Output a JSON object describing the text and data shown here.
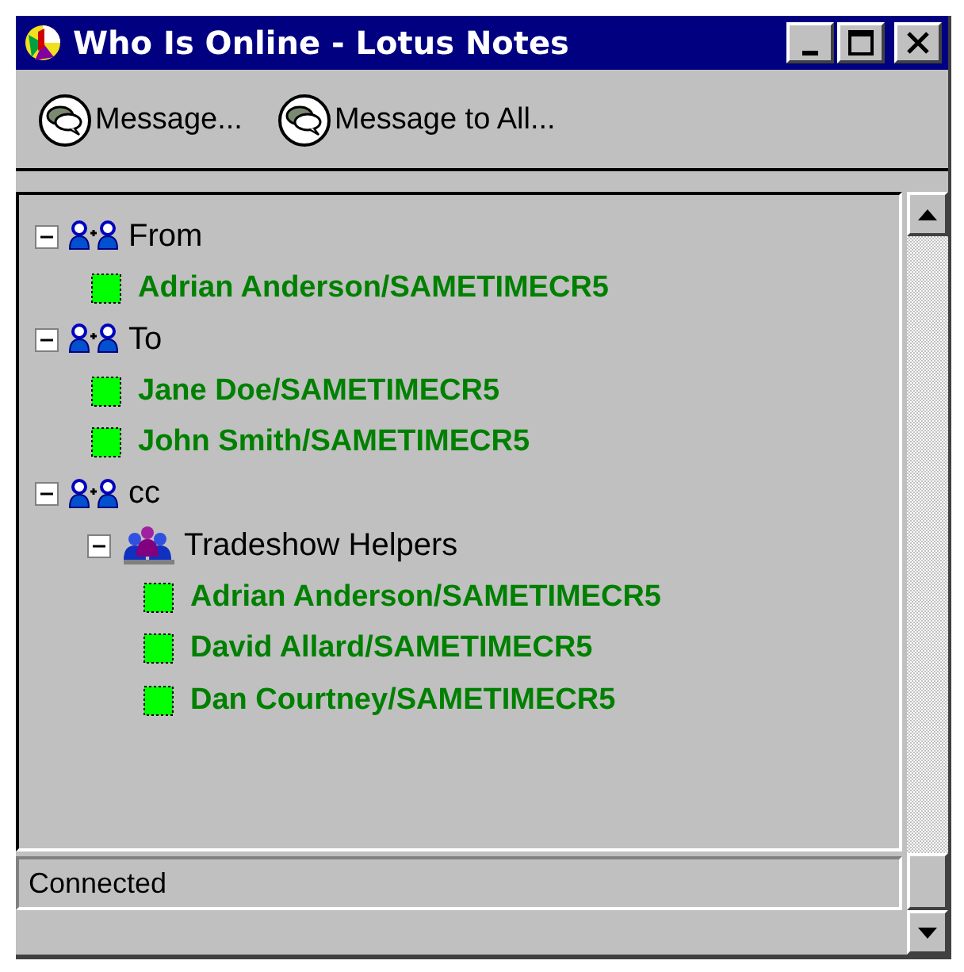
{
  "window": {
    "title": "Who Is Online - Lotus Notes"
  },
  "toolbar": [
    {
      "label": "Message..."
    },
    {
      "label": "Message to All..."
    }
  ],
  "tree": [
    {
      "kind": "group",
      "label": "From",
      "expanded": true,
      "children": [
        {
          "kind": "person",
          "label": "Adrian Anderson/SAMETIMECR5"
        }
      ]
    },
    {
      "kind": "group",
      "label": "To",
      "expanded": true,
      "children": [
        {
          "kind": "person",
          "label": "Jane Doe/SAMETIMECR5"
        },
        {
          "kind": "person",
          "label": "John Smith/SAMETIMECR5"
        }
      ]
    },
    {
      "kind": "group",
      "label": "cc",
      "expanded": true,
      "children": [
        {
          "kind": "team",
          "label": "Tradeshow Helpers",
          "expanded": true,
          "children": [
            {
              "kind": "person",
              "label": "Adrian Anderson/SAMETIMECR5"
            },
            {
              "kind": "person",
              "label": "David Allard/SAMETIMECR5"
            },
            {
              "kind": "person",
              "label": "Dan Courtney/SAMETIMECR5"
            }
          ]
        }
      ]
    }
  ],
  "status_bar": {
    "text": "Connected"
  }
}
